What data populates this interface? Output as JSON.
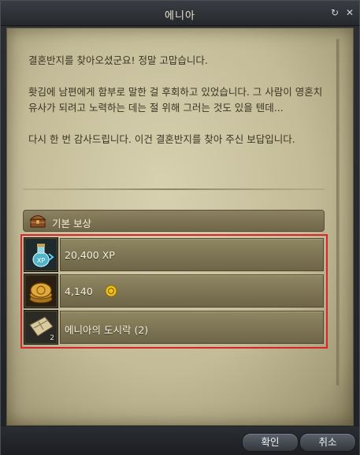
{
  "window": {
    "title": "에니아",
    "refresh_icon": "refresh-icon",
    "close_icon": "close-icon"
  },
  "dialogue": {
    "paragraphs": [
      "결혼반지를 찾아오셨군요! 정말 고맙습니다.",
      "홧김에 남편에게 함부로 말한 걸 후회하고 있었습니다. 그 사람이 영혼치유사가 되려고 노력하는 데는 절 위해 그러는 것도 있을 텐데...",
      "다시 한 번 감사드립니다. 이건 결혼반지를 찾아 주신 보답입니다."
    ]
  },
  "rewards": {
    "header_label": "기본 보상",
    "header_icon": "treasure-chest-icon",
    "items": [
      {
        "icon": "xp-potion-icon",
        "text": "20,400 XP"
      },
      {
        "icon": "gold-coins-icon",
        "text": "4,140",
        "currency_icon": "gold-coin-icon"
      },
      {
        "icon": "lunchbox-icon",
        "text": "에니아의 도시락 (2)",
        "count": "2"
      }
    ]
  },
  "buttons": {
    "confirm": "확인",
    "cancel": "취소"
  },
  "colors": {
    "highlight": "#d8242a",
    "parchment": "#c3bb97",
    "text": "#3b3423"
  }
}
